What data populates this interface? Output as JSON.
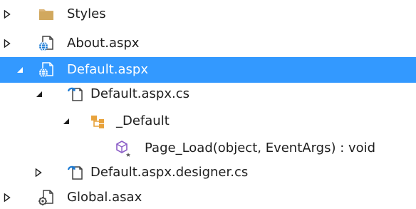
{
  "solution_explorer": {
    "items": [
      {
        "label": "Styles",
        "expander": "collapsed",
        "icon": "folder-icon",
        "selected": false
      },
      {
        "label": "About.aspx",
        "expander": "collapsed",
        "icon": "aspx-web-form-icon",
        "selected": false
      },
      {
        "label": "Default.aspx",
        "expander": "expanded",
        "icon": "aspx-web-form-icon",
        "selected": true
      },
      {
        "label": "Default.aspx.cs",
        "expander": "expanded",
        "icon": "csharp-file-icon",
        "selected": false
      },
      {
        "label": "_Default",
        "expander": "expanded",
        "icon": "class-icon",
        "selected": false
      },
      {
        "label": "Page_Load(object, EventArgs) : void",
        "expander": "none",
        "icon": "method-icon",
        "selected": false
      },
      {
        "label": "Default.aspx.designer.cs",
        "expander": "collapsed",
        "icon": "csharp-file-icon",
        "selected": false
      },
      {
        "label": "Global.asax",
        "expander": "collapsed",
        "icon": "asax-file-icon",
        "selected": false
      }
    ]
  },
  "colors": {
    "selection_background": "#3399ff",
    "selection_text": "#ffffff",
    "text": "#1e1e1e",
    "folder": "#dcb67a",
    "web_globe": "#1c7bd4",
    "class_orange": "#e8a33d",
    "method_purple": "#8b5dc7"
  }
}
